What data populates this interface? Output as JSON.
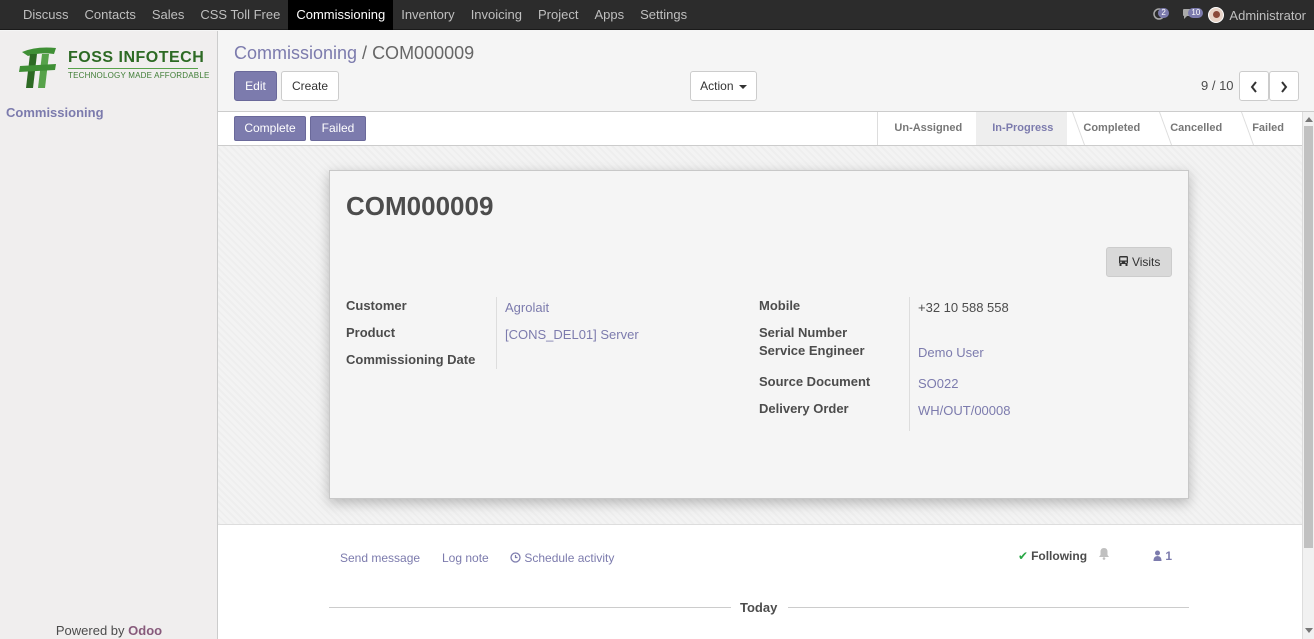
{
  "topbar": {
    "menu": [
      "Discuss",
      "Contacts",
      "Sales",
      "CSS Toll Free",
      "Commissioning",
      "Inventory",
      "Invoicing",
      "Project",
      "Apps",
      "Settings"
    ],
    "active_index": 4,
    "activity_count": "2",
    "messages_count": "10",
    "user": "Administrator"
  },
  "sidebar": {
    "logo_name": "FOSS INFOTECH",
    "logo_tagline": "TECHNOLOGY MADE AFFORDABLE",
    "section": "Commissioning",
    "powered_prefix": "Powered by ",
    "powered_brand": "Odoo"
  },
  "control": {
    "breadcrumb_parent": "Commissioning",
    "breadcrumb_sep": " / ",
    "breadcrumb_current": "COM000009",
    "edit": "Edit",
    "create": "Create",
    "action": "Action",
    "pager": "9 / 10"
  },
  "statusbar": {
    "complete": "Complete",
    "failed": "Failed",
    "stages": [
      "Un-Assigned",
      "In-Progress",
      "Completed",
      "Cancelled",
      "Failed"
    ],
    "current_stage": "In-Progress"
  },
  "form": {
    "title": "COM000009",
    "visits": "Visits",
    "left": {
      "customer_label": "Customer",
      "customer_value": "Agrolait",
      "product_label": "Product",
      "product_value": "[CONS_DEL01] Server",
      "date_label": "Commissioning Date"
    },
    "right": {
      "mobile_label": "Mobile",
      "mobile_value": "+32 10 588 558",
      "serial_label": "Serial Number",
      "engineer_label": "Service Engineer",
      "engineer_value": "Demo User",
      "source_label": "Source Document",
      "source_value": "SO022",
      "delivery_label": "Delivery Order",
      "delivery_value": "WH/OUT/00008"
    }
  },
  "chatter": {
    "send_message": "Send message",
    "log_note": "Log note",
    "schedule_activity": "Schedule activity",
    "following": "Following",
    "followers_count": "1",
    "today": "Today"
  },
  "colors": {
    "primary": "#7c7bad",
    "navbar": "#2c2c2c",
    "odoo_brand": "#875a7b",
    "logo_green": "#2d6a24"
  }
}
